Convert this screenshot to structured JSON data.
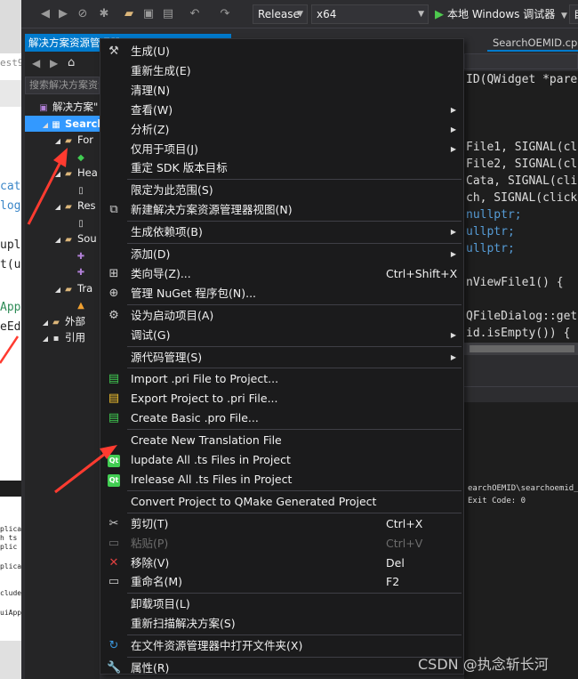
{
  "toolbar": {
    "config": "Release",
    "platform": "x64",
    "run_label": "本地 Windows 调试器",
    "auto": "自动"
  },
  "solution_explorer": {
    "tab_title": "解决方案资源管理器",
    "search_placeholder": "搜索解决方案资源管",
    "tree": [
      {
        "label": "解决方案\"",
        "depth": 0,
        "icon": "solution-icon"
      },
      {
        "label": "Search",
        "depth": 1,
        "icon": "project-icon",
        "selected": true
      },
      {
        "label": "For",
        "depth": 2,
        "icon": "folder-icon"
      },
      {
        "label": "",
        "depth": 3,
        "icon": "ui-file-icon"
      },
      {
        "label": "Hea",
        "depth": 2,
        "icon": "folder-icon"
      },
      {
        "label": "",
        "depth": 3,
        "icon": "header-file-icon"
      },
      {
        "label": "Res",
        "depth": 2,
        "icon": "folder-icon"
      },
      {
        "label": "",
        "depth": 3,
        "icon": "file-icon"
      },
      {
        "label": "Sou",
        "depth": 2,
        "icon": "folder-icon"
      },
      {
        "label": "",
        "depth": 3,
        "icon": "cpp-file-icon"
      },
      {
        "label": "",
        "depth": 3,
        "icon": "cpp-file-icon"
      },
      {
        "label": "Tra",
        "depth": 2,
        "icon": "folder-icon"
      },
      {
        "label": "",
        "depth": 3,
        "icon": "ts-file-icon"
      },
      {
        "label": "外部",
        "depth": 1,
        "icon": "external-deps-icon"
      },
      {
        "label": "引用",
        "depth": 1,
        "icon": "references-icon"
      }
    ]
  },
  "editor": {
    "tab": "SearchOEMID.cpp",
    "lines": [
      "ID(QWidget *pare",
      "",
      "",
      "",
      "File1, SIGNAL(cl",
      "File2, SIGNAL(cl",
      "Cata, SIGNAL(cli",
      "ch, SIGNAL(click",
      "nullptr;",
      "ullptr;",
      "ullptr;",
      "",
      "nViewFile1() {",
      "",
      "QFileDialog::get",
      "id.isEmpty()) {"
    ],
    "output_lines": [
      "earchOEMID\\searchoemid_",
      " Exit Code: 0"
    ]
  },
  "context_menu": {
    "items": [
      {
        "label": "生成(U)",
        "icon": "build-icon"
      },
      {
        "label": "重新生成(E)"
      },
      {
        "label": "清理(N)"
      },
      {
        "label": "查看(W)",
        "submenu": true
      },
      {
        "label": "分析(Z)",
        "submenu": true
      },
      {
        "label": "仅用于项目(J)",
        "submenu": true
      },
      {
        "label": "重定 SDK 版本目标"
      },
      {
        "sep": true
      },
      {
        "label": "限定为此范围(S)"
      },
      {
        "label": "新建解决方案资源管理器视图(N)",
        "icon": "new-view-icon"
      },
      {
        "sep": true
      },
      {
        "label": "生成依赖项(B)",
        "submenu": true
      },
      {
        "sep": true
      },
      {
        "label": "添加(D)",
        "submenu": true
      },
      {
        "label": "类向导(Z)...",
        "shortcut": "Ctrl+Shift+X",
        "icon": "class-wizard-icon"
      },
      {
        "label": "管理 NuGet 程序包(N)...",
        "icon": "nuget-icon"
      },
      {
        "sep": true
      },
      {
        "label": "设为启动项目(A)",
        "icon": "gear-icon"
      },
      {
        "label": "调试(G)",
        "submenu": true
      },
      {
        "sep": true
      },
      {
        "label": "源代码管理(S)",
        "submenu": true
      },
      {
        "sep": true
      },
      {
        "label": "Import .pri File to Project...",
        "icon": "import-pri-icon"
      },
      {
        "label": "Export Project to .pri File...",
        "icon": "export-pri-icon"
      },
      {
        "label": "Create Basic .pro File...",
        "icon": "create-pro-icon"
      },
      {
        "sep": true
      },
      {
        "label": "Create New Translation File"
      },
      {
        "label": "lupdate All .ts Files in Project",
        "icon": "qt-icon"
      },
      {
        "label": "lrelease All .ts Files in Project",
        "icon": "qt-icon"
      },
      {
        "sep": true
      },
      {
        "label": "Convert Project to QMake Generated Project"
      },
      {
        "sep": true
      },
      {
        "label": "剪切(T)",
        "shortcut": "Ctrl+X",
        "icon": "cut-icon"
      },
      {
        "label": "粘贴(P)",
        "shortcut": "Ctrl+V",
        "icon": "paste-icon",
        "disabled": true
      },
      {
        "label": "移除(V)",
        "shortcut": "Del",
        "icon": "remove-icon"
      },
      {
        "label": "重命名(M)",
        "shortcut": "F2",
        "icon": "rename-icon"
      },
      {
        "sep": true
      },
      {
        "label": "卸载项目(L)"
      },
      {
        "label": "重新扫描解决方案(S)"
      },
      {
        "sep": true
      },
      {
        "label": "在文件资源管理器中打开文件夹(X)",
        "icon": "open-folder-icon"
      },
      {
        "sep": true
      },
      {
        "label": "属性(R)",
        "icon": "wrench-icon"
      }
    ]
  },
  "background_fragments": {
    "a": "est9",
    "b": "cat",
    "c": "log",
    "d": "upl",
    "e": "t(u",
    "f": "App",
    "g": "eEd"
  },
  "watermark": "CSDN @执念斩长河",
  "colors": {
    "accent": "#007acc",
    "selection": "#3399ff",
    "menu_bg": "#1b1b1c",
    "arrow": "#ff3b30"
  }
}
